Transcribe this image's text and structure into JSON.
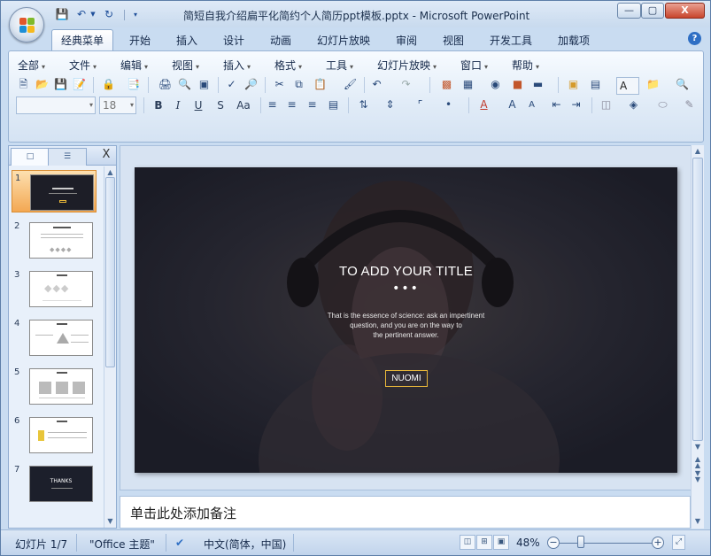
{
  "window": {
    "title": "简短自我介绍扁平化简约个人简历ppt模板.pptx - Microsoft PowerPoint",
    "minimize": "—",
    "maximize": "▢",
    "close": "X"
  },
  "quick_access": [
    "save-icon",
    "undo-icon",
    "redo-icon"
  ],
  "ribbon_tabs": [
    "经典菜单",
    "开始",
    "插入",
    "设计",
    "动画",
    "幻灯片放映",
    "审阅",
    "视图",
    "开发工具",
    "加载项"
  ],
  "active_tab": "经典菜单",
  "menu": [
    "全部",
    "文件",
    "编辑",
    "视图",
    "插入",
    "格式",
    "工具",
    "幻灯片放映",
    "窗口",
    "帮助"
  ],
  "font_name": "",
  "font_size": "18",
  "format_buttons": [
    "B",
    "I",
    "U",
    "S",
    "Aa"
  ],
  "toolbar_combo_label": "A",
  "slides_panel": {
    "close": "X",
    "slides": [
      {
        "num": "1",
        "thumb_title": "",
        "selected": true
      },
      {
        "num": "2",
        "thumb_title": "",
        "selected": false
      },
      {
        "num": "3",
        "thumb_title": "",
        "selected": false
      },
      {
        "num": "4",
        "thumb_title": "",
        "selected": false
      },
      {
        "num": "5",
        "thumb_title": "",
        "selected": false
      },
      {
        "num": "6",
        "thumb_title": "",
        "selected": false
      },
      {
        "num": "7",
        "thumb_title": "THANKS",
        "selected": false
      }
    ]
  },
  "slide": {
    "title": "TO ADD YOUR TITLE",
    "dots": "•••",
    "body_line1": "That is the essence of science: ask an impertinent",
    "body_line2": "question, and you are on the way to",
    "body_line3": "the pertinent answer.",
    "button": "NUOMI",
    "accent": "#e8b73a"
  },
  "notes_placeholder": "单击此处添加备注",
  "status": {
    "slide_info": "幻灯片 1/7",
    "theme": "\"Office 主题\"",
    "language": "中文(简体，中国)",
    "zoom": "48%"
  }
}
